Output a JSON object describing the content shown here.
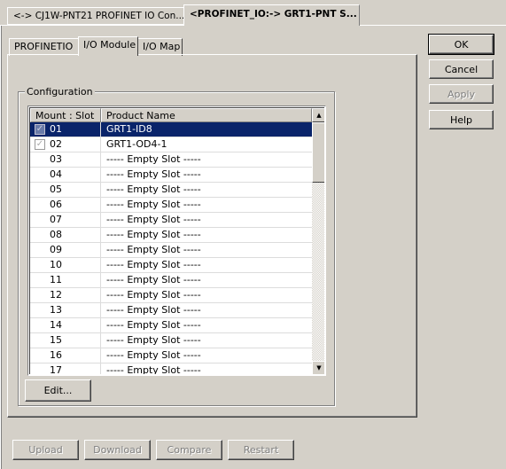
{
  "outer_tabs": [
    {
      "label": "<-> CJ1W-PNT21 PROFINET IO Con...",
      "active": false
    },
    {
      "label": "<PROFINET_IO:-> GRT1-PNT S...",
      "active": true
    }
  ],
  "inner_tabs": [
    {
      "label": "PROFINETIO",
      "active": false
    },
    {
      "label": "I/O Module",
      "active": true
    },
    {
      "label": "I/O Map",
      "active": false
    }
  ],
  "configuration": {
    "group_label": "Configuration",
    "columns": [
      "Mount : Slot",
      "Product Name"
    ],
    "rows": [
      {
        "slot": "01",
        "name": "GRT1-ID8",
        "checked": true,
        "selected": true
      },
      {
        "slot": "02",
        "name": "GRT1-OD4-1",
        "checked": true,
        "selected": false
      },
      {
        "slot": "03",
        "name": "-----  Empty Slot  -----"
      },
      {
        "slot": "04",
        "name": "-----  Empty Slot  -----"
      },
      {
        "slot": "05",
        "name": "-----  Empty Slot  -----"
      },
      {
        "slot": "06",
        "name": "-----  Empty Slot  -----"
      },
      {
        "slot": "07",
        "name": "-----  Empty Slot  -----"
      },
      {
        "slot": "08",
        "name": "-----  Empty Slot  -----"
      },
      {
        "slot": "09",
        "name": "-----  Empty Slot  -----"
      },
      {
        "slot": "10",
        "name": "-----  Empty Slot  -----"
      },
      {
        "slot": "11",
        "name": "-----  Empty Slot  -----"
      },
      {
        "slot": "12",
        "name": "-----  Empty Slot  -----"
      },
      {
        "slot": "13",
        "name": "-----  Empty Slot  -----"
      },
      {
        "slot": "14",
        "name": "-----  Empty Slot  -----"
      },
      {
        "slot": "15",
        "name": "-----  Empty Slot  -----"
      },
      {
        "slot": "16",
        "name": "-----  Empty Slot  -----"
      },
      {
        "slot": "17",
        "name": "-----  Empty Slot  -----"
      }
    ],
    "edit_label": "Edit..."
  },
  "dialog_buttons": {
    "ok": "OK",
    "cancel": "Cancel",
    "apply": "Apply",
    "help": "Help"
  },
  "bottom_buttons": {
    "upload": "Upload",
    "download": "Download",
    "compare": "Compare",
    "restart": "Restart"
  },
  "icons": {
    "check": "✓",
    "scroll_up": "▲",
    "scroll_down": "▼"
  }
}
